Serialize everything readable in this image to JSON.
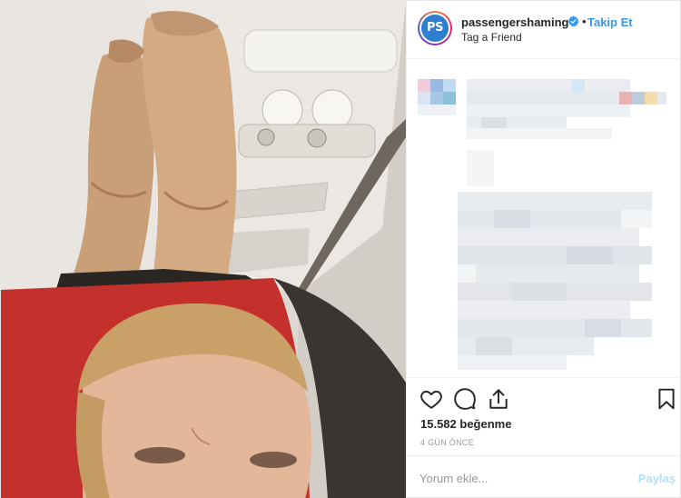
{
  "post": {
    "account": {
      "username": "passengershaming",
      "avatar_text": "PS",
      "verified": true,
      "follow_label": "Takip Et",
      "separator": "•",
      "location": "Tag a Friend"
    },
    "likes_text": "15.582 beğenme",
    "time_text": "4 GÜN ÖNCE",
    "comment": {
      "placeholder": "Yorum ekle...",
      "post_label": "Paylaş"
    },
    "icons": {
      "like": "heart-icon",
      "comment": "comment-bubble-icon",
      "share": "share-icon",
      "save": "bookmark-icon",
      "verified": "verified-badge-icon"
    },
    "colors": {
      "link_blue": "#3897f0",
      "post_disabled": "#b2dffc",
      "seat_red": "#c4302b",
      "border": "#efefef"
    }
  }
}
